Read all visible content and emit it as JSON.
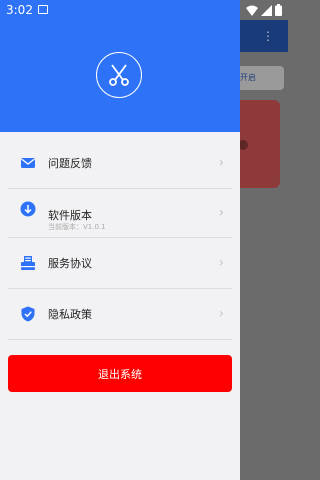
{
  "status_bar": {
    "time": "3:02"
  },
  "background_app": {
    "chip_text": "在开启",
    "more_icon": "⋮"
  },
  "drawer": {
    "logo_icon": "scissors-icon",
    "menu": [
      {
        "label": "问题反馈",
        "icon": "mail-icon"
      },
      {
        "label": "软件版本",
        "sub": "当前版本：V1.0.1",
        "icon": "download-icon"
      },
      {
        "label": "服务协议",
        "icon": "inbox-icon"
      },
      {
        "label": "隐私政策",
        "icon": "shield-check-icon"
      }
    ],
    "logout_label": "退出系统"
  },
  "colors": {
    "primary": "#2e73f7",
    "danger": "#ff0000",
    "drawer_bg": "#f2f2f4"
  }
}
